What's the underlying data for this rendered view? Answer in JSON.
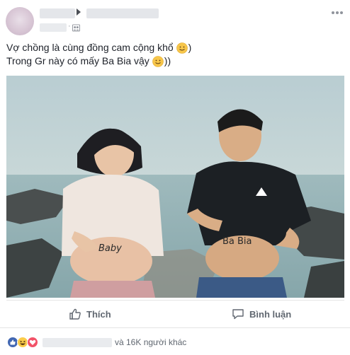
{
  "post": {
    "line1": "Vợ chồng là cùng đồng cam cộng khổ",
    "line1_suffix": ")",
    "line2": "Trong Gr này có mấy Ba Bia vậy",
    "line2_suffix": "))"
  },
  "photo": {
    "belly_label_left": "Baby",
    "belly_label_right": "Ba Bia"
  },
  "actions": {
    "like_label": "Thích",
    "comment_label": "Bình luận"
  },
  "reactions": {
    "summary": "và 16K người khác",
    "icons": [
      "like-icon",
      "haha-icon",
      "love-icon"
    ]
  },
  "colors": {
    "brand_blue": "#4267b2",
    "love_red": "#f25268",
    "haha_yellow": "#fbcc4a",
    "text_primary": "#1d2129",
    "text_secondary": "#606770"
  }
}
